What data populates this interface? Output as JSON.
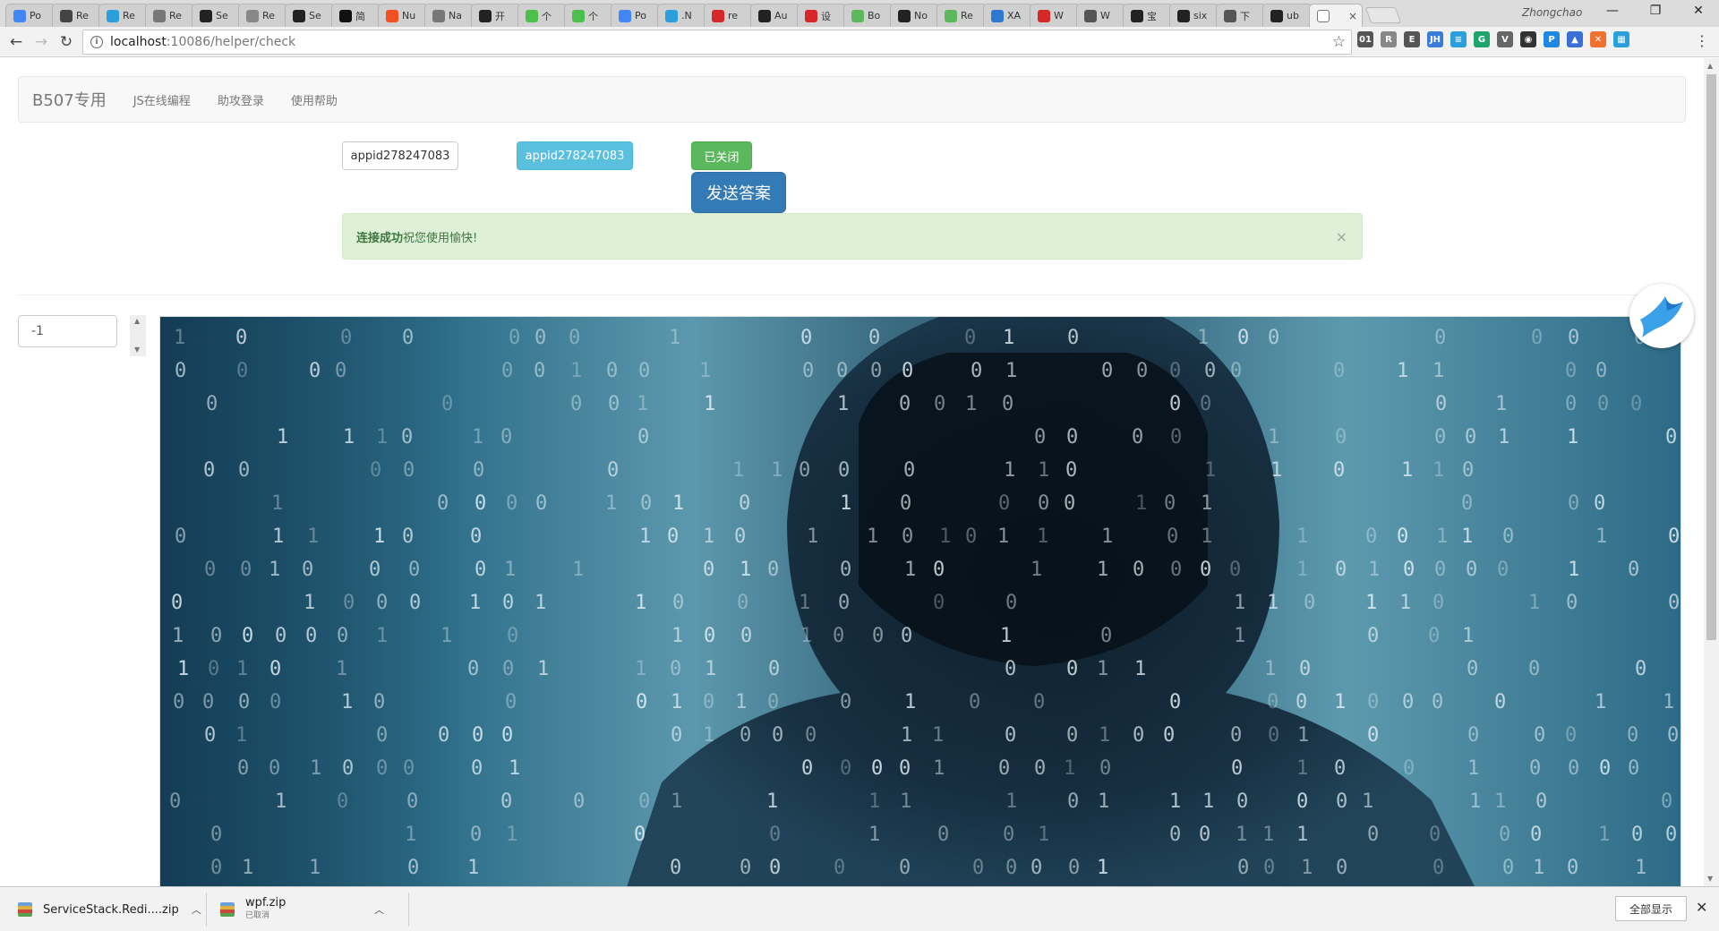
{
  "browser": {
    "tabs": [
      {
        "label": "Po",
        "color": "#4285f4"
      },
      {
        "label": "Re",
        "color": "#444444"
      },
      {
        "label": "Re",
        "color": "#2b9fdb"
      },
      {
        "label": "Re",
        "color": "#777777"
      },
      {
        "label": "Se",
        "color": "#222222"
      },
      {
        "label": "Re",
        "color": "#888888"
      },
      {
        "label": "Se",
        "color": "#222222"
      },
      {
        "label": "简",
        "color": "#111111"
      },
      {
        "label": "Nu",
        "color": "#f25022"
      },
      {
        "label": "Na",
        "color": "#777777"
      },
      {
        "label": "开",
        "color": "#222222"
      },
      {
        "label": "个",
        "color": "#4cbf4c"
      },
      {
        "label": "个",
        "color": "#4cbf4c"
      },
      {
        "label": "Po",
        "color": "#4285f4"
      },
      {
        "label": ".N",
        "color": "#2b9fdb"
      },
      {
        "label": "re",
        "color": "#d62828"
      },
      {
        "label": "Au",
        "color": "#222222"
      },
      {
        "label": "设",
        "color": "#d62828"
      },
      {
        "label": "Bo",
        "color": "#5cb85c"
      },
      {
        "label": "No",
        "color": "#222222"
      },
      {
        "label": "Re",
        "color": "#5cb85c"
      },
      {
        "label": "XA",
        "color": "#2b79d0"
      },
      {
        "label": "W",
        "color": "#d62828"
      },
      {
        "label": "W",
        "color": "#555555"
      },
      {
        "label": "宝",
        "color": "#222222"
      },
      {
        "label": "six",
        "color": "#222222"
      },
      {
        "label": "下",
        "color": "#555555"
      },
      {
        "label": "ub",
        "color": "#222222"
      }
    ],
    "active_tab_close": "×",
    "profile_name": "Zhongchao",
    "window_controls": {
      "minimize": "—",
      "restore": "❐",
      "close": "✕"
    },
    "nav": {
      "back": "←",
      "forward": "→",
      "reload": "↻",
      "star": "☆",
      "info": "i",
      "menu": "⋮"
    },
    "url_host": "localhost",
    "url_path": ":10086/helper/check",
    "extensions": [
      {
        "name": "01-ext-icon",
        "label": "01",
        "color": "#555555"
      },
      {
        "name": "r-ext-icon",
        "label": "R",
        "color": "#888888"
      },
      {
        "name": "evernote-ext-icon",
        "label": "E",
        "color": "#555555"
      },
      {
        "name": "jh-ext-icon",
        "label": "JH",
        "color": "#3b7dd8"
      },
      {
        "name": "note-ext-icon",
        "label": "≡",
        "color": "#2b9fdb"
      },
      {
        "name": "grammarly-ext-icon",
        "label": "G",
        "color": "#1fa46b"
      },
      {
        "name": "vue-ext-icon",
        "label": "V",
        "color": "#666666"
      },
      {
        "name": "ghost-ext-icon",
        "label": "◉",
        "color": "#333333"
      },
      {
        "name": "p-ext-icon",
        "label": "P",
        "color": "#1e88e5"
      },
      {
        "name": "cap-ext-icon",
        "label": "▲",
        "color": "#3b6fd8"
      },
      {
        "name": "x-ext-icon",
        "label": "✕",
        "color": "#f07030"
      },
      {
        "name": "board-ext-icon",
        "label": "▦",
        "color": "#2b9fdb"
      }
    ]
  },
  "page": {
    "brand": "B507专用",
    "nav_links": [
      "JS在线编程",
      "助攻登录",
      "使用帮助"
    ],
    "appid_default": "appid278247083",
    "appid_info": "appid278247083",
    "status_label": "已关闭",
    "send_label": "发送答案",
    "alert_strong": "连接成功",
    "alert_text": "祝您使用愉快!",
    "alert_close": "×",
    "number_value": "-1",
    "spinner_up": "▲",
    "spinner_down": "▼"
  },
  "downloads": [
    {
      "name": "ServiceStack.Redi....zip",
      "status": ""
    },
    {
      "name": "wpf.zip",
      "status": "已取消"
    }
  ],
  "shelf": {
    "show_all": "全部显示",
    "close": "✕",
    "chevron": "︿"
  }
}
